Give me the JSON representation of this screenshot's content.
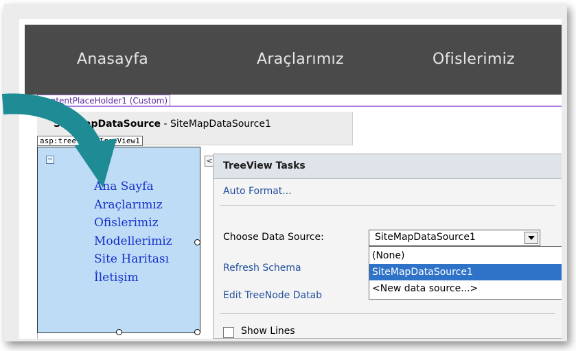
{
  "nav": {
    "items": [
      "Anasayfa",
      "Araçlarımız",
      "Ofislerimiz"
    ]
  },
  "content_placeholder": {
    "tag": "ContentPlaceHolder1 (Custom)"
  },
  "sitemap_datasource": {
    "type_label": "SiteMapDataSource",
    "separator": " - ",
    "id": "SiteMapDataSource1"
  },
  "treeview": {
    "tag": "asp:treeview#TreeView1",
    "expand_glyph": "−",
    "nodes": [
      "Ana Sayfa",
      "Araçlarımız",
      "Ofislerimiz",
      "Modellerimiz",
      "Site Haritası",
      "İletişim"
    ]
  },
  "smart_tag": {
    "glyph": "<"
  },
  "tasks": {
    "title": "TreeView Tasks",
    "auto_format": "Auto Format...",
    "choose_label": "Choose Data Source:",
    "selected": "SiteMapDataSource1",
    "options": [
      "(None)",
      "SiteMapDataSource1",
      "<New data source...>"
    ],
    "refresh_schema": "Refresh Schema",
    "edit_bindings": "Edit TreeNode Datab",
    "show_lines": "Show Lines"
  },
  "colors": {
    "arrow": "#1f8c95",
    "nav_bg": "#4a4a4a",
    "tree_bg": "#bfdcf7",
    "selection": "#2f73c9"
  }
}
